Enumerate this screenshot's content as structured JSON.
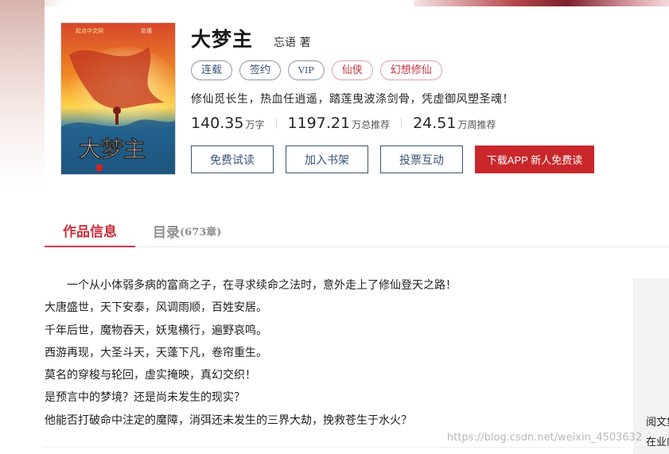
{
  "book": {
    "title": "大梦主",
    "author": "忘语 著",
    "cover": {
      "logo_text": "起点中文网",
      "author_text": "忘语",
      "title_text": "大梦主",
      "colors": {
        "sky": "#d8462a",
        "fire": "#f08a24",
        "glow": "#ffd54f",
        "water": "#2f7fb0",
        "deep": "#173e5c"
      }
    },
    "tags": [
      {
        "label": "连载",
        "style": "blue"
      },
      {
        "label": "签约",
        "style": "blue"
      },
      {
        "label": "VIP",
        "style": "blue"
      },
      {
        "label": "仙侠",
        "style": "red"
      },
      {
        "label": "幻想修仙",
        "style": "red"
      }
    ],
    "description": "修仙觅长生，热血任逍遥，踏莲曳波涤剑骨，凭虚御风塑圣魂！",
    "stats": [
      {
        "value": "140.35",
        "unit": "万字"
      },
      {
        "value": "1197.21",
        "unit": "万总推荐"
      },
      {
        "value": "24.51",
        "unit": "万周推荐"
      }
    ],
    "actions": {
      "free_read": "免费试读",
      "add_shelf": "加入书架",
      "vote": "投票互动",
      "download_app": "下载APP 新人免费读"
    }
  },
  "tabs": {
    "info": "作品信息",
    "catalog": "目录",
    "catalog_count": "(673章)"
  },
  "intro": [
    "一个从小体弱多病的富商之子，在寻求续命之法时，意外走上了修仙登天之路！",
    "大唐盛世，天下安泰，风调雨顺，百姓安居。",
    "千年后世，魔物吞天，妖鬼横行，遍野哀鸣。",
    "西游再现，大圣斗天，天蓬下凡，卷帘重生。",
    "莫名的穿梭与轮回，虚实掩映，真幻交织！",
    "是预言中的梦境？还是尚未发生的现实？",
    "他能否打破命中注定的魔障，消弭还未发生的三界大劫，挽救苍生于水火？"
  ],
  "side_panel": {
    "line1": "阅文集",
    "line2": "在业内"
  },
  "watermark": "https://blog.csdn.net/weixin_4503632",
  "colors": {
    "accent_red": "#c9272b",
    "tab_active": "#c9303c",
    "button_border": "#3b5376",
    "tag_blue_border": "#8a99ad",
    "tag_red_border": "#e0a0a6"
  }
}
